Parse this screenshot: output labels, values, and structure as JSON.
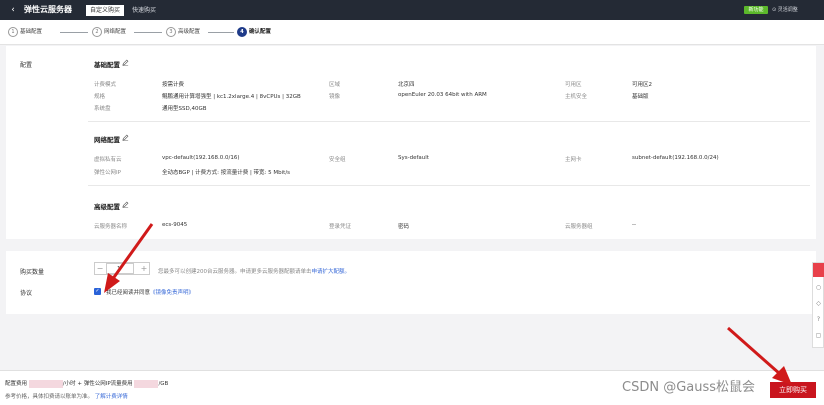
{
  "header": {
    "title": "弹性云服务器",
    "tabs": [
      {
        "label": "自定义购买",
        "active": true
      },
      {
        "label": "快速购买",
        "active": false
      }
    ],
    "tag": "新功能",
    "stock_label": "灵活调整"
  },
  "steps": [
    {
      "num": "1",
      "label": "基础配置"
    },
    {
      "num": "2",
      "label": "网络配置"
    },
    {
      "num": "3",
      "label": "高级配置"
    },
    {
      "num": "4",
      "label": "确认配置"
    }
  ],
  "config": {
    "section_label": "配置",
    "basic": {
      "title": "基础配置",
      "rows": [
        {
          "label": "计费模式",
          "value": "按需计费"
        },
        {
          "label": "规格",
          "value": "鲲鹏通用计算增强型 | kc1.2xlarge.4 | 8vCPUs | 32GB"
        },
        {
          "label": "系统盘",
          "value": "通用型SSD,40GB"
        }
      ],
      "mid": [
        {
          "label": "区域",
          "value": "北京四"
        },
        {
          "label": "镜像",
          "value": "openEuler 20.03 64bit with ARM"
        }
      ],
      "right": [
        {
          "label": "可用区",
          "value": "可用区2"
        },
        {
          "label": "主机安全",
          "value": "基础版"
        }
      ]
    },
    "network": {
      "title": "网络配置",
      "rows": [
        {
          "label": "虚拟私有云",
          "value": "vpc-default(192.168.0.0/16)"
        },
        {
          "label": "弹性公网IP",
          "value": "全动态BGP | 计费方式: 按流量计费 | 带宽: 5 Mbit/s"
        }
      ],
      "mid": [
        {
          "label": "安全组",
          "value": "Sys-default"
        }
      ],
      "right": [
        {
          "label": "主网卡",
          "value": "subnet-default(192.168.0.0/24)"
        }
      ]
    },
    "advanced": {
      "title": "高级配置",
      "rows": [
        {
          "label": "云服务器名称",
          "value": "ecs-9045"
        }
      ],
      "mid": [
        {
          "label": "登录凭证",
          "value": "密码"
        }
      ],
      "right": [
        {
          "label": "云服务器组",
          "value": "--"
        }
      ]
    }
  },
  "purchase": {
    "qty_label": "购买数量",
    "qty_value": "1",
    "qty_hint_pre": "您最多可以创建200台云服务器。申请更多云服务器配额请单击",
    "qty_hint_link": "申请扩大配额。",
    "agreement_label": "协议",
    "agreement_text": "我已经阅读并同意",
    "agreement_link": "《镜像免责声明》"
  },
  "footer": {
    "fee_label": "配置费用",
    "fee_unit": "/小时",
    "plus": "+",
    "ip_fee_label": "弹性公网IP流量费用",
    "ip_fee_unit": "/GB",
    "note": "参考价格，具体扣费请以账单为准。",
    "note_link": "了解计费详情",
    "buy_button": "立即购买",
    "watermark": "CSDN @Gauss松鼠会"
  },
  "colors": {
    "topbar": "#242a35",
    "accent_blue": "#1f3b89",
    "buy_red": "#c9151e",
    "arrow_red": "#d01a1a",
    "tag_green": "#5cb82b"
  }
}
